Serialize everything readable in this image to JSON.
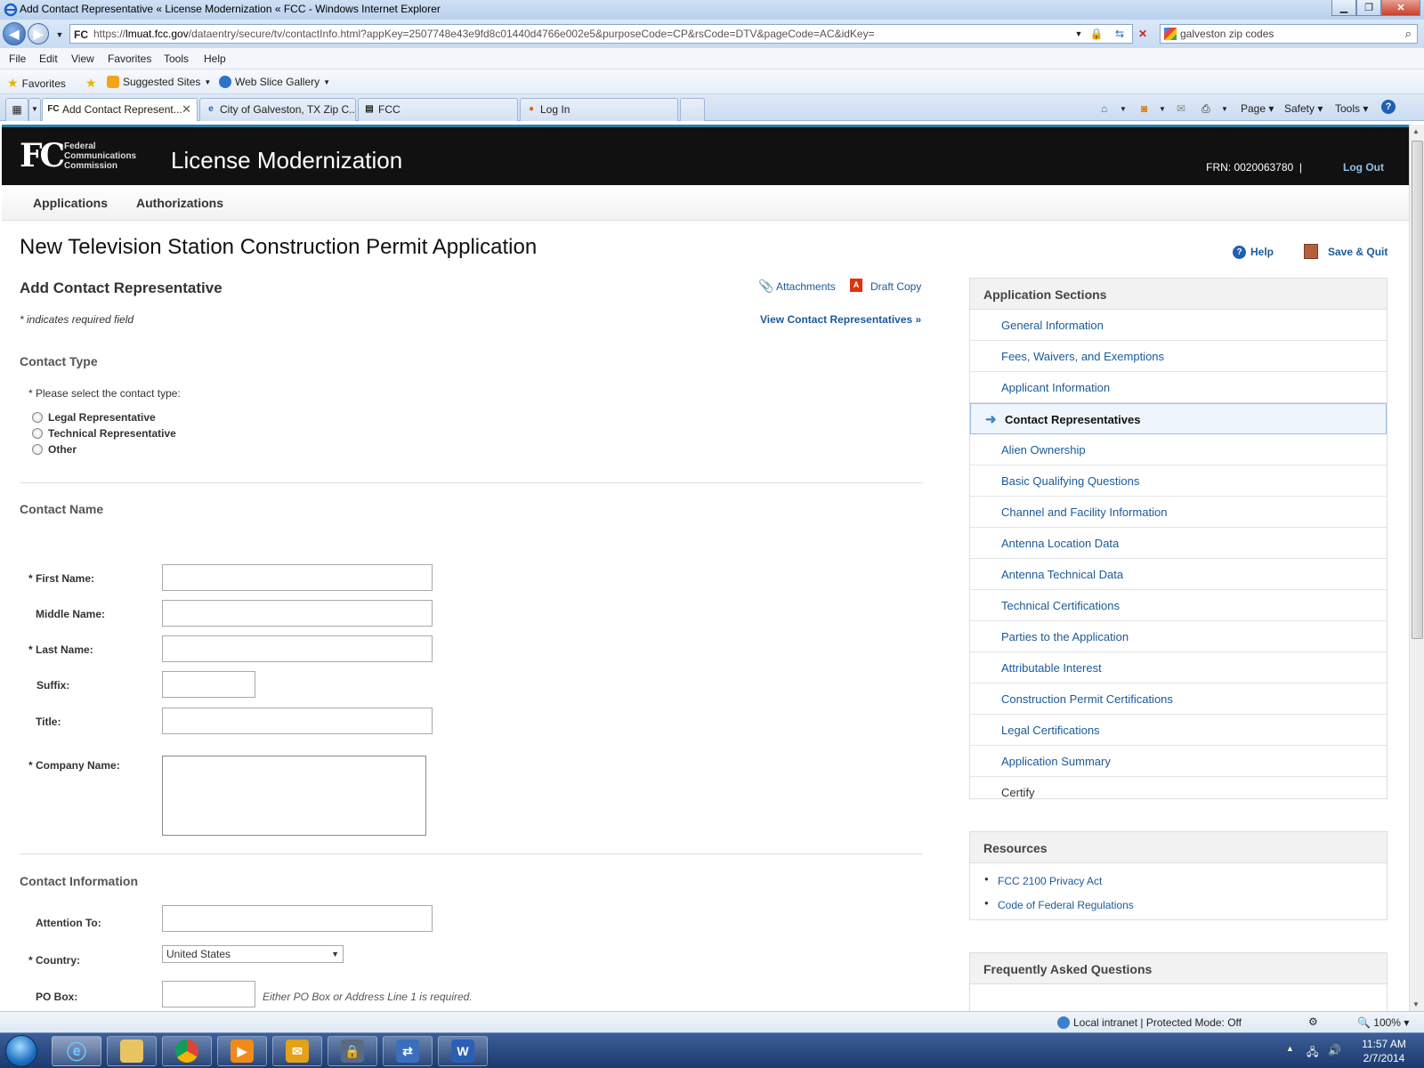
{
  "window": {
    "title": "Add Contact Representative « License Modernization « FCC - Windows Internet Explorer"
  },
  "address_bar": {
    "url_scheme": "https://",
    "url_host": "lmuat.fcc.gov",
    "url_path": "/dataentry/secure/tv/contactInfo.html?appKey=2507748e43e9fd8c01440d4766e002e5&purposeCode=CP&rsCode=DTV&pageCode=AC&idKey=",
    "favicon": "FC",
    "search_value": "galveston zip codes"
  },
  "menu": [
    "File",
    "Edit",
    "View",
    "Favorites",
    "Tools",
    "Help"
  ],
  "favorites_bar": {
    "favorites": "Favorites",
    "suggested_sites": "Suggested Sites",
    "web_slice_gallery": "Web Slice Gallery"
  },
  "tabs": [
    {
      "label": "Add Contact Represent...",
      "icon": "FC"
    },
    {
      "label": "City of Galveston, TX Zip C...",
      "icon": "e"
    },
    {
      "label": "FCC",
      "icon": "▤"
    },
    {
      "label": "Log In",
      "icon": "●"
    }
  ],
  "command_bar": {
    "page": "Page",
    "safety": "Safety",
    "tools": "Tools"
  },
  "header": {
    "logo": "FC",
    "agency_line1": "Federal",
    "agency_line2": "Communications",
    "agency_line3": "Commission",
    "app_title": "License Modernization",
    "frn": "FRN: 0020063780",
    "separator": "|",
    "logout": "Log Out"
  },
  "nav": {
    "applications": "Applications",
    "authorizations": "Authorizations"
  },
  "page": {
    "title": "New Television Station Construction Permit Application",
    "help": "Help",
    "save_quit": "Save & Quit",
    "section_title": "Add Contact Representative",
    "attachments": "Attachments",
    "draft_copy": "Draft Copy",
    "draft_icon": "A",
    "required_note": "* indicates required field",
    "view_reps": "View Contact Representatives »"
  },
  "contact_type": {
    "heading": "Contact Type",
    "prompt": "* Please select the contact type:",
    "options": [
      "Legal Representative",
      "Technical Representative",
      "Other"
    ]
  },
  "contact_name": {
    "heading": "Contact Name",
    "first_name": "* First Name:",
    "middle_name": "Middle Name:",
    "last_name": "* Last Name:",
    "suffix": "Suffix:",
    "title": "Title:",
    "company_name": "* Company Name:"
  },
  "contact_info": {
    "heading": "Contact Information",
    "attention_to": "Attention To:",
    "country": "* Country:",
    "country_value": "United States",
    "po_box": "PO Box:",
    "po_hint": "Either PO Box or Address Line 1 is required."
  },
  "sidebar": {
    "heading": "Application Sections",
    "items": [
      "General Information",
      "Fees, Waivers, and Exemptions",
      "Applicant Information",
      "Contact Representatives",
      "Alien Ownership",
      "Basic Qualifying Questions",
      "Channel and Facility Information",
      "Antenna Location Data",
      "Antenna Technical Data",
      "Technical Certifications",
      "Parties to the Application",
      "Attributable Interest",
      "Construction Permit Certifications",
      "Legal Certifications",
      "Application Summary",
      "Certify"
    ],
    "current_index": 3
  },
  "resources": {
    "heading": "Resources",
    "items": [
      "FCC 2100 Privacy Act",
      "Code of Federal Regulations"
    ]
  },
  "faq": {
    "heading": "Frequently Asked Questions"
  },
  "status_bar": {
    "zone": "Local intranet | Protected Mode: Off",
    "zoom": "100%"
  },
  "taskbar": {
    "time": "11:57 AM",
    "date": "2/7/2014",
    "word_icon": "W"
  },
  "colors": {
    "link": "#1a5a9a",
    "header_bg": "#111111",
    "accent": "#2c7ea8"
  }
}
